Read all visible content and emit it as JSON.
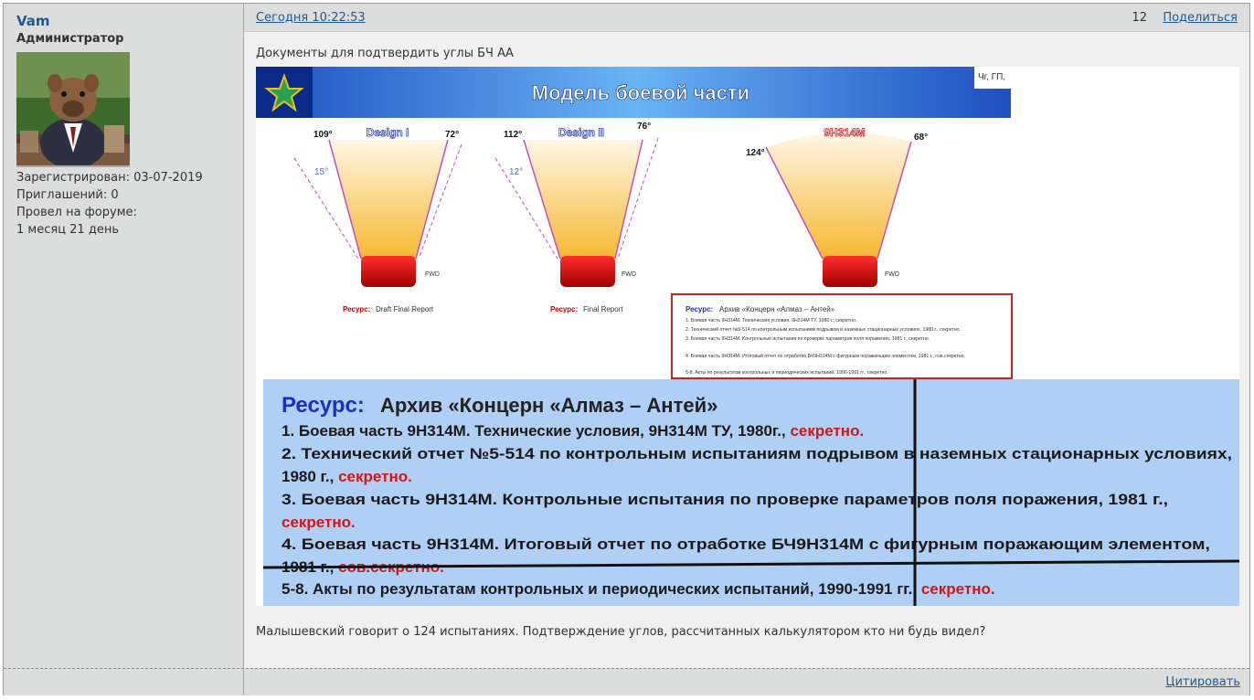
{
  "author": {
    "username": "Vam",
    "role": "Администратор",
    "registered": "Зарегистрирован: 03-07-2019",
    "invites": "Приглашений: 0",
    "time_label": "Провел на форуме:",
    "time_value": "1 месяц 21 день"
  },
  "post": {
    "date": "Сегодня 10:22:53",
    "number": "12",
    "share_label": "Поделиться",
    "text_top": "Документы для подтвердить углы БЧ АА",
    "text_bottom": "Малышевский говорит о 124 испытаниях. Подтверждение углов, рассчитанных калькулятором кто ни будь видел?",
    "quote_label": "Цитировать"
  },
  "slide": {
    "title": "Модель боевой части",
    "corner": "Чг, ГП,",
    "diagrams": [
      {
        "name": "Design I",
        "left_angle": "109°",
        "right_angle": "72°",
        "extra_angle": "15°",
        "fwd": "FWD",
        "res_label": "Ресурс:",
        "res_value": "Draft Final Report"
      },
      {
        "name": "Design II",
        "left_angle": "112°",
        "right_angle": "76°",
        "extra_angle": "12°",
        "fwd": "FWD",
        "res_label": "Ресурс:",
        "res_value": "Final Report"
      },
      {
        "name": "9Н314М",
        "left_angle": "124°",
        "right_angle": "68°",
        "fwd": "FWD"
      }
    ],
    "small_box": {
      "title_label": "Ресурс:",
      "title_value": "Архив «Концерн «Алмаз – Антей»",
      "lines": [
        "1. Боевая часть 9Н314М. Технические условия, 9Н314М ТУ, 1980 г., секретно.",
        "2. Технический отчет №5-514 по контрольным испытаниям подрывом в наземных стационарных условиях, 1980 г., секретно.",
        "3. Боевая часть 9Н314М. Контрольные испытания по проверке параметров поля поражения, 1981 г., секретно.",
        "4. Боевая часть 9Н314М. Итоговый отчет по отработке БЧ9Н314М с фигурным поражающим элементом, 1981 г., сов.секретно.",
        "5-8. Акты по результатам контрольных и периодических испытаний, 1990-1991 гг., секретно."
      ]
    },
    "big_box": {
      "title_label": "Ресурс:",
      "title_value": "Архив «Концерн «Алмаз – Антей»",
      "line1": "1. Боевая часть 9Н314М. Технические условия, 9Н314М ТУ, 1980г., ",
      "line1_red": "секретно.",
      "line2": "2. Технический отчет №5-514 по контрольным испытаниям подрывом в наземных стационарных условиях,",
      "line2b": "1980 г., ",
      "line2_red": "секретно.",
      "line3": "3. Боевая часть 9Н314М. Контрольные испытания по проверке параметров поля поражения, 1981 г.,",
      "line3_red": "секретно.",
      "line4": "4. Боевая часть 9Н314М. Итоговый отчет по отработке БЧ9Н314М с фигурным поражающим элементом,",
      "line4b": "1981 г., ",
      "line4_red": "сов.секретно.",
      "line5": "5-8. Акты по результатам контрольных и периодических испытаний, 1990-1991 гг., ",
      "line5_red": "секретно."
    }
  },
  "colors": {
    "link": "#1f5a92",
    "sidebar": "#dcdddd",
    "content": "#f0f0f0",
    "slide_blue": "#4a8fe0",
    "red": "#cc0000",
    "big_box_bg": "#b0cff5"
  }
}
